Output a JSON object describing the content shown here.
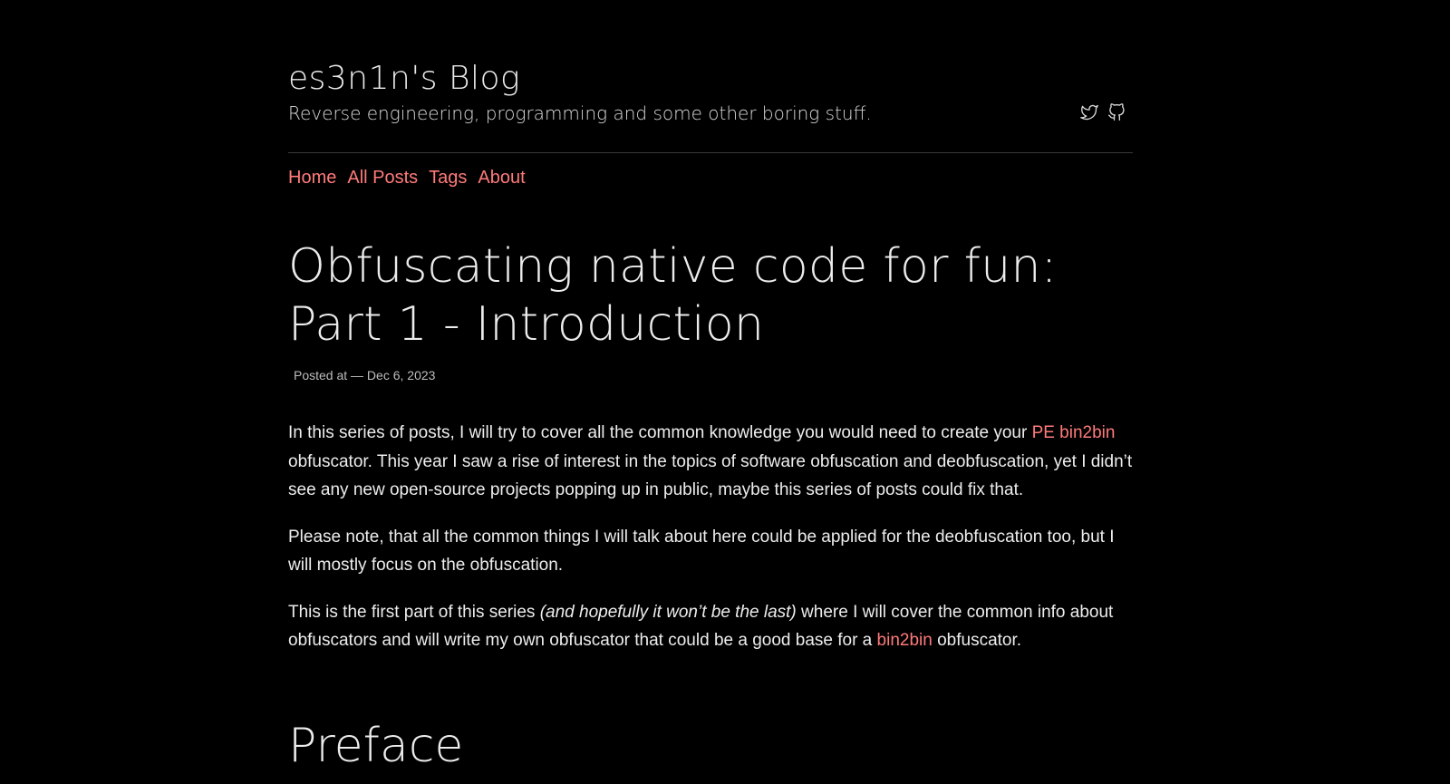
{
  "site": {
    "title": "es3n1n's Blog",
    "subtitle": "Reverse engineering, programming and some other boring stuff."
  },
  "social": {
    "twitter_icon": "twitter-icon",
    "github_icon": "github-icon"
  },
  "nav": {
    "items": [
      {
        "label": "Home"
      },
      {
        "label": "All Posts"
      },
      {
        "label": "Tags"
      },
      {
        "label": "About"
      }
    ]
  },
  "post": {
    "title": "Obfuscating native code for fun: Part 1 - Introduction",
    "meta": "Posted at — Dec 6, 2023",
    "p1": {
      "before": "In this series of posts, I will try to cover all the common knowledge you would need to create your ",
      "link": "PE bin2bin",
      "after": " obfuscator. This year I saw a rise of interest in the topics of software obfuscation and deobfuscation, yet I didn’t see any new open-source projects popping up in public, maybe this series of posts could fix that."
    },
    "p2": "Please note, that all the common things I will talk about here could be applied for the deobfuscation too, but I will mostly focus on the obfuscation.",
    "p3": {
      "before": "This is the first part of this series ",
      "emphasis": "(and hopefully it won’t be the last)",
      "middle": " where I will cover the common info about obfuscators and will write my own obfuscator that could be a good base for a ",
      "link": "bin2bin",
      "after": " obfuscator."
    },
    "section_heading": "Preface"
  },
  "colors": {
    "background": "#000000",
    "accent": "#ff7a7a",
    "text": "#ededed",
    "divider": "#3a3a3a"
  }
}
